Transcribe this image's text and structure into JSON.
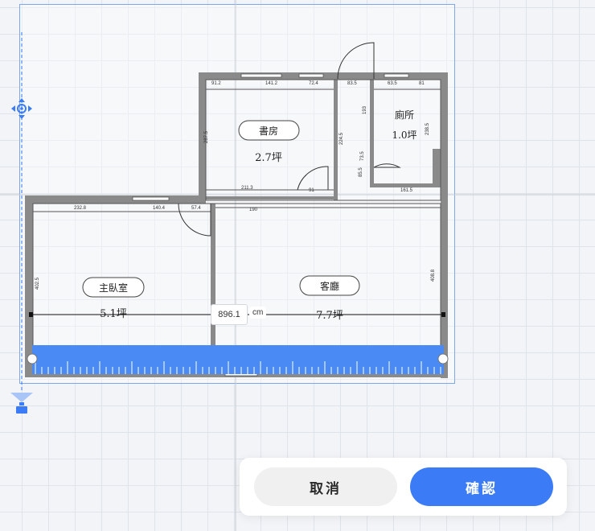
{
  "floorplan": {
    "rooms": [
      {
        "name": "書房",
        "size": "2.7坪"
      },
      {
        "name": "廁所",
        "size": "1.0坪"
      },
      {
        "name": "主臥室",
        "size": "5.1坪"
      },
      {
        "name": "客廳",
        "size": "7.7坪"
      }
    ],
    "dimensions": [
      "91.2",
      "141.2",
      "72.4",
      "83.5",
      "63.5",
      "81",
      "287.5",
      "224.5",
      "193",
      "73.5",
      "85.5",
      "238.5",
      "211.3",
      "91",
      "161.5",
      "232.8",
      "140.4",
      "57.4",
      "190",
      "402.5",
      "408.8"
    ]
  },
  "measure": {
    "value": "896.1",
    "unit": "cm"
  },
  "actions": {
    "cancel_label": "取消",
    "confirm_label": "確認"
  },
  "colors": {
    "accent": "#3b7bf6",
    "ruler": "#4a8af4",
    "wall": "#7a7a7a"
  },
  "icons": {
    "move_handle": "move-arrows-icon",
    "rotate_handle": "rotate-icon"
  }
}
